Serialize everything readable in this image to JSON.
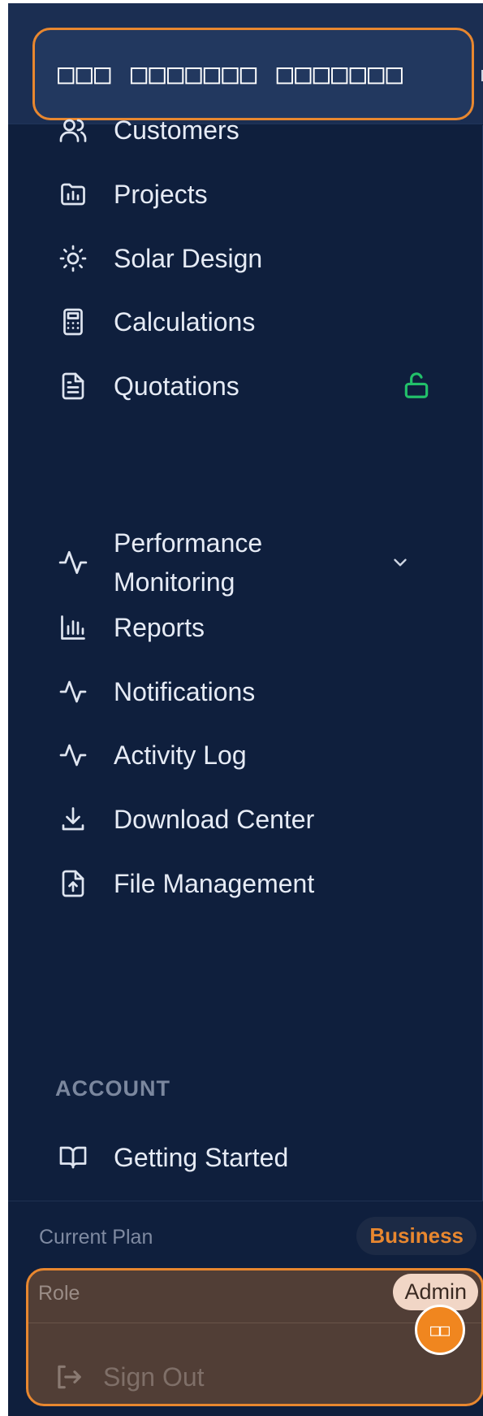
{
  "header": {
    "title": "□□□ □□□□□□□ □□□□□□□"
  },
  "nav": {
    "customers": "Customers",
    "projects": "Projects",
    "solar_design": "Solar Design",
    "calculations": "Calculations",
    "quotations": "Quotations",
    "performance_monitoring": "Performance Monitoring",
    "reports": "Reports",
    "notifications": "Notifications",
    "activity_log": "Activity Log",
    "download_center": "Download Center",
    "file_management": "File Management"
  },
  "account_section": {
    "heading": "ACCOUNT",
    "getting_started": "Getting Started"
  },
  "footer": {
    "plan_label": "Current Plan",
    "plan_value": "Business",
    "role_label": "Role",
    "role_value": "Admin",
    "toggle_glyph": "□□",
    "sign_out": "Sign Out"
  },
  "colors": {
    "sidebar_bg": "#0f1f3d",
    "accent": "#e8872f",
    "unlocked": "#22c06a"
  },
  "icons": {
    "customers": "users-icon",
    "projects": "folder-icon",
    "solar_design": "sun-icon",
    "calculations": "calculator-icon",
    "quotations": "document-icon",
    "quotations_status": "unlock-icon",
    "performance_monitoring": "activity-icon",
    "performance_expand": "chevron-down-icon",
    "reports": "bar-chart-icon",
    "notifications": "activity-icon",
    "activity_log": "activity-icon",
    "download_center": "download-icon",
    "file_management": "file-upload-icon",
    "getting_started": "book-open-icon",
    "sign_out": "log-out-icon"
  }
}
